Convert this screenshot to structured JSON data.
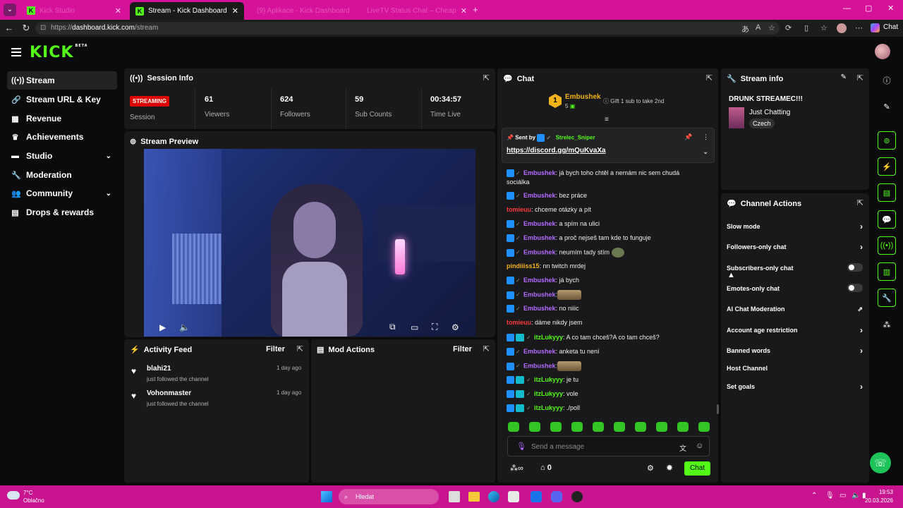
{
  "browser": {
    "tabs": [
      {
        "title": "Kick Studio"
      },
      {
        "title": "Stream - Kick Dashboard"
      },
      {
        "title": "(9) Aplikace - Kick Dashboard"
      },
      {
        "title": "LiveTV Status Chat – Cheap"
      }
    ],
    "url_prefix": "https://",
    "url_domain": "dashboard.kick.com",
    "url_path": "/stream",
    "profile_label": "Chat"
  },
  "header": {
    "logo": "KICK",
    "logo_sup": "BETA"
  },
  "sidebar": {
    "items": [
      {
        "label": "Stream",
        "icon": "broadcast-icon"
      },
      {
        "label": "Stream URL & Key",
        "icon": "link-icon"
      },
      {
        "label": "Revenue",
        "icon": "money-icon"
      },
      {
        "label": "Achievements",
        "icon": "trophy-icon"
      },
      {
        "label": "Studio",
        "icon": "studio-icon"
      },
      {
        "label": "Moderation",
        "icon": "wrench-icon"
      },
      {
        "label": "Community",
        "icon": "people-icon"
      },
      {
        "label": "Drops & rewards",
        "icon": "gift-icon"
      }
    ]
  },
  "session_info": {
    "title": "Session Info",
    "badge": "STREAMING",
    "session_label": "Session",
    "stats": [
      {
        "value": "61",
        "label": "Viewers"
      },
      {
        "value": "624",
        "label": "Followers"
      },
      {
        "value": "59",
        "label": "Sub Counts"
      },
      {
        "value": "00:34:57",
        "label": "Time Live"
      }
    ]
  },
  "preview": {
    "title": "Stream Preview"
  },
  "activity": {
    "title": "Activity Feed",
    "filter": "Filter",
    "items": [
      {
        "name": "blahi21",
        "action": "just followed the channel",
        "time": "1 day ago"
      },
      {
        "name": "Vohonmaster",
        "action": "just followed the channel",
        "time": "1 day ago"
      }
    ]
  },
  "mod_actions": {
    "title": "Mod Actions",
    "filter": "Filter"
  },
  "chat": {
    "title": "Chat",
    "gifter": {
      "name": "Embushek",
      "count": "5",
      "rank": "1",
      "promo": "Gift 1 sub to take 2nd"
    },
    "pinned": {
      "sent_by_label": "Sent by",
      "sender": "Strelec_Sniper",
      "link": "https://discord.gg/mQuKvaXa"
    },
    "messages": [
      {
        "user": "Embushek",
        "text": ": já bych toho chtěl a nemám nic sem chudá",
        "cont": "sociálka"
      },
      {
        "user": "Embushek",
        "text": ": bez práce"
      },
      {
        "user": "tomieuu",
        "text": ": chceme otázky a pít"
      },
      {
        "user": "Embushek",
        "text": ": a spím na ulici"
      },
      {
        "user": "Embushek",
        "text": ": a proč nejseš tam kde to funguje"
      },
      {
        "user": "Embushek",
        "text": ": neumím tady stím"
      },
      {
        "user": "pindiiiss15",
        "text": ": nn twitch mrdej"
      },
      {
        "user": "Embushek",
        "text": ": já bych"
      },
      {
        "user": "Embushek",
        "text": ":"
      },
      {
        "user": "Embushek",
        "text": ": no niiic"
      },
      {
        "user": "tomieuu",
        "text": ": dáme nikdy jsem"
      },
      {
        "user": "itzLukyyy",
        "text": ": A co tam chceš?A co tam chceš?"
      },
      {
        "user": "Embushek",
        "text": ": anketa tu není"
      },
      {
        "user": "Embushek",
        "text": ":"
      },
      {
        "user": "itzLukyyy",
        "text": ": je tu"
      },
      {
        "user": "itzLukyyy",
        "text": ": vole"
      },
      {
        "user": "itzLukyyy",
        "text": ": ./poll"
      }
    ],
    "input_placeholder": "Send a message",
    "points": "0",
    "send_label": "Chat"
  },
  "stream_info": {
    "title": "Stream info",
    "stream_title": "DRUNK STREAMEC!!!",
    "category": "Just Chatting",
    "language": "Czech"
  },
  "channel_actions": {
    "title": "Channel Actions",
    "items": [
      {
        "label": "Slow mode"
      },
      {
        "label": "Followers-only chat"
      },
      {
        "label": "Subscribers-only chat"
      },
      {
        "label": "Emotes-only chat"
      },
      {
        "label": "AI Chat Moderation"
      },
      {
        "label": "Account age restriction"
      },
      {
        "label": "Banned words"
      },
      {
        "label": "Host Channel"
      },
      {
        "label": "Set goals"
      }
    ]
  },
  "taskbar": {
    "temp": "7°C",
    "weather": "Oblačno",
    "search": "Hledat",
    "time": "19:53",
    "date": "20.03.2026"
  },
  "colors": {
    "brand": "#53fc18",
    "chrome": "#d6119a",
    "live": "#dd0000",
    "username_purple": "#b36bff"
  }
}
